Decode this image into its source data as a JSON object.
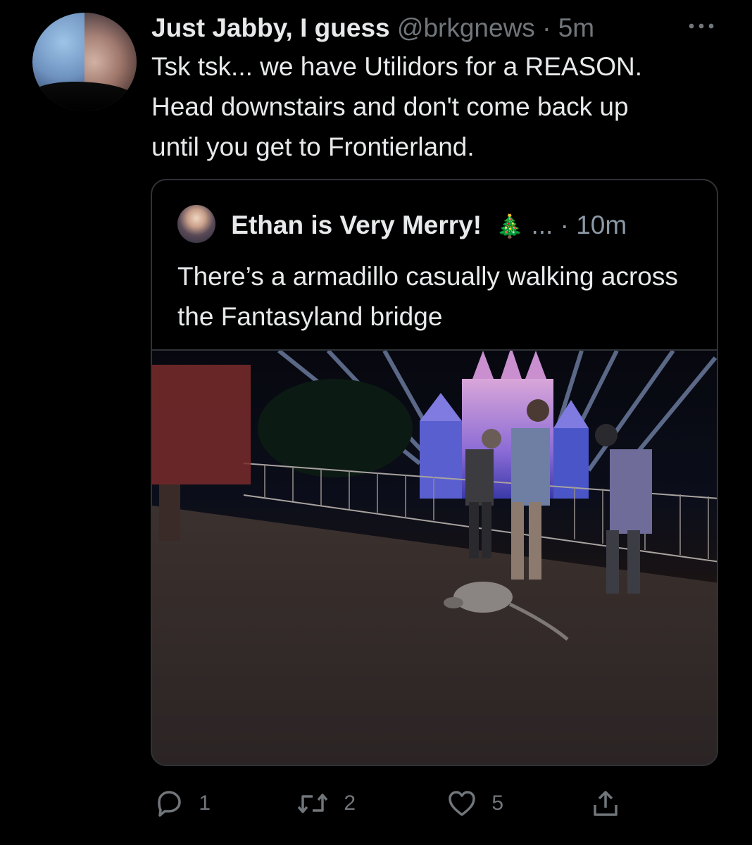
{
  "tweet": {
    "author_name": "Just Jabby, I guess",
    "handle": "@brkgnews",
    "separator": "·",
    "time": "5m",
    "more_icon": "more-horizontal-icon",
    "text": "Tsk tsk... we have Utilidors for a REASON.\nHead downstairs and don't come back up\nuntil you get to Frontierland."
  },
  "quoted_tweet": {
    "author_name": "Ethan is Very Merry!",
    "emoji": "🎄",
    "ellipsis": "...",
    "separator": "·",
    "time": "10m",
    "text": "There’s a armadillo casually walking across the Fantasyland bridge",
    "photo": "armadillo-on-bridge-photo"
  },
  "actions": {
    "reply_count": "1",
    "retweet_count": "2",
    "like_count": "5",
    "reply_icon": "reply-icon",
    "retweet_icon": "retweet-icon",
    "like_icon": "heart-icon",
    "share_icon": "share-icon"
  },
  "colors": {
    "background": "#000000",
    "text_primary": "#e7e9ea",
    "text_secondary": "#71767b",
    "border": "#2f3336"
  }
}
